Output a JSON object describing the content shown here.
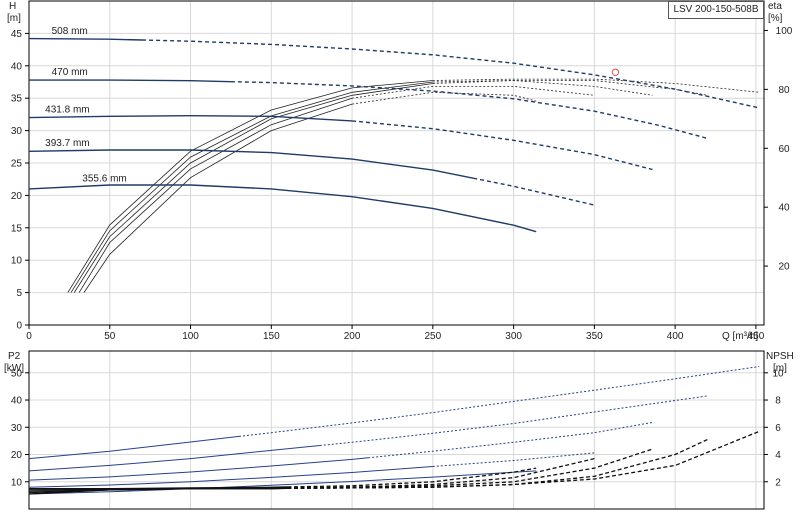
{
  "model_label": "LSV 200-150-508B",
  "colors": {
    "curve": "#1f3c66",
    "power": "#27408b",
    "npsh": "#111111",
    "efficiency": "#222222",
    "marker": "#e05050",
    "axis": "#000000",
    "grid": "#d8d8d8"
  },
  "chart_data": [
    {
      "type": "line",
      "title": "",
      "xlabel": "Q [m³/h]",
      "ylabel": "H\n[m]",
      "y2label": "eta\n[%]",
      "xlim": [
        0,
        455
      ],
      "ylim": [
        0,
        50
      ],
      "y2lim": [
        0,
        110
      ],
      "x_ticks": [
        0,
        50,
        100,
        150,
        200,
        250,
        300,
        350,
        400,
        450
      ],
      "y_ticks": [
        0,
        5,
        10,
        15,
        20,
        25,
        30,
        35,
        40,
        45
      ],
      "y2_ticks": [
        20,
        40,
        60,
        80,
        100
      ],
      "grid": true,
      "series": [
        {
          "name": "508 mm",
          "x": [
            0,
            50,
            100,
            150,
            200,
            250,
            300,
            350,
            400,
            452
          ],
          "y": [
            44.2,
            44.1,
            43.8,
            43.3,
            42.6,
            41.7,
            40.4,
            38.6,
            36.4,
            33.5
          ],
          "solid_until": 70,
          "label_x": 14
        },
        {
          "name": "470 mm",
          "x": [
            0,
            50,
            100,
            150,
            200,
            250,
            300,
            350,
            390,
            420
          ],
          "y": [
            37.8,
            37.8,
            37.7,
            37.4,
            36.9,
            36.1,
            34.9,
            33.0,
            30.8,
            28.8
          ],
          "solid_until": 125,
          "label_x": 14
        },
        {
          "name": "431.8 mm",
          "x": [
            0,
            50,
            100,
            150,
            200,
            250,
            300,
            350,
            386
          ],
          "y": [
            32.0,
            32.2,
            32.3,
            32.2,
            31.5,
            30.3,
            28.5,
            26.3,
            24.0
          ],
          "solid_until": 200,
          "label_x": 10
        },
        {
          "name": "393.7 mm",
          "x": [
            0,
            50,
            100,
            150,
            200,
            250,
            300,
            350
          ],
          "y": [
            26.8,
            27.0,
            27.0,
            26.6,
            25.6,
            23.9,
            21.4,
            18.5
          ],
          "solid_until": 275,
          "label_x": 10
        },
        {
          "name": "355.6 mm",
          "x": [
            0,
            50,
            100,
            150,
            200,
            250,
            300,
            314
          ],
          "y": [
            21.0,
            21.6,
            21.6,
            21.0,
            19.8,
            18.0,
            15.4,
            14.4
          ],
          "solid_until": 314,
          "label_x": 33
        }
      ],
      "efficiency_series": [
        {
          "x": [
            24,
            50,
            100,
            150,
            200,
            250,
            300,
            335,
            350,
            400,
            452
          ],
          "y": [
            11,
            34,
            59,
            73,
            80.5,
            83,
            83.5,
            83.5,
            83.5,
            82,
            79
          ]
        },
        {
          "x": [
            26,
            50,
            100,
            150,
            200,
            250,
            300,
            350,
            400,
            420
          ],
          "y": [
            11,
            32,
            57,
            71,
            79,
            82.5,
            83,
            83,
            80,
            78
          ]
        },
        {
          "x": [
            28,
            50,
            100,
            150,
            200,
            250,
            300,
            350,
            386
          ],
          "y": [
            11,
            30,
            55,
            70,
            78,
            82,
            83,
            81,
            78
          ]
        },
        {
          "x": [
            31,
            50,
            100,
            150,
            200,
            250,
            300,
            350
          ],
          "y": [
            11,
            28,
            53,
            68,
            77,
            81,
            81,
            78
          ]
        },
        {
          "x": [
            34,
            50,
            100,
            150,
            200,
            250,
            300,
            314
          ],
          "y": [
            11,
            24,
            50,
            66,
            75,
            79,
            78,
            76
          ]
        }
      ],
      "duty_point": {
        "x": 363,
        "y": 39.0
      }
    },
    {
      "type": "line",
      "title": "",
      "xlabel": "",
      "ylabel": "P2\n[kW]",
      "y2label": "NPSH\n[m]",
      "xlim": [
        0,
        455
      ],
      "ylim": [
        0,
        58
      ],
      "y2lim": [
        0,
        11.6
      ],
      "y_ticks": [
        10,
        20,
        30,
        40,
        50
      ],
      "y2_ticks": [
        2,
        4,
        6,
        8,
        10
      ],
      "grid": true,
      "power_series": [
        {
          "x": [
            0,
            50,
            100,
            150,
            200,
            250,
            300,
            350,
            400,
            452
          ],
          "y": [
            18.5,
            21.2,
            24.6,
            28.0,
            31.6,
            35.4,
            39.5,
            43.6,
            47.8,
            52.3
          ],
          "solid_until": 130
        },
        {
          "x": [
            0,
            50,
            100,
            150,
            200,
            250,
            300,
            350,
            420
          ],
          "y": [
            14.0,
            16.0,
            18.5,
            21.5,
            24.5,
            27.8,
            31.4,
            35.6,
            41.5
          ],
          "solid_until": 180
        },
        {
          "x": [
            0,
            50,
            100,
            150,
            200,
            250,
            300,
            350,
            386
          ],
          "y": [
            10.6,
            11.8,
            13.6,
            15.8,
            18.2,
            21.2,
            24.5,
            28.0,
            31.8
          ],
          "solid_until": 210
        },
        {
          "x": [
            0,
            50,
            100,
            150,
            200,
            250,
            300,
            350
          ],
          "y": [
            8.0,
            8.8,
            10.0,
            11.6,
            13.4,
            15.6,
            17.8,
            20.6
          ],
          "solid_until": 250
        },
        {
          "x": [
            0,
            50,
            100,
            150,
            200,
            250,
            300,
            314
          ],
          "y": [
            5.5,
            6.3,
            7.4,
            8.7,
            10.1,
            11.7,
            13.5,
            14.0
          ],
          "solid_until": 314
        }
      ],
      "npsh_series": [
        {
          "x": [
            0,
            50,
            100,
            150,
            200,
            250,
            300,
            350,
            400,
            452
          ],
          "y": [
            1.1,
            1.4,
            1.5,
            1.5,
            1.55,
            1.6,
            1.8,
            2.2,
            3.2,
            5.7
          ]
        },
        {
          "x": [
            0,
            50,
            100,
            150,
            200,
            250,
            300,
            350,
            400,
            420
          ],
          "y": [
            1.2,
            1.4,
            1.5,
            1.5,
            1.55,
            1.6,
            1.8,
            2.4,
            4.0,
            5.1
          ]
        },
        {
          "x": [
            0,
            50,
            100,
            150,
            200,
            250,
            300,
            350,
            386
          ],
          "y": [
            1.3,
            1.4,
            1.5,
            1.5,
            1.6,
            1.7,
            2.0,
            3.0,
            4.4
          ]
        },
        {
          "x": [
            0,
            50,
            100,
            150,
            200,
            250,
            300,
            350
          ],
          "y": [
            1.4,
            1.45,
            1.5,
            1.55,
            1.6,
            1.8,
            2.3,
            3.7
          ]
        },
        {
          "x": [
            0,
            50,
            100,
            150,
            200,
            250,
            300,
            314
          ],
          "y": [
            1.5,
            1.5,
            1.55,
            1.6,
            1.7,
            2.0,
            2.7,
            3.0
          ]
        }
      ]
    }
  ]
}
